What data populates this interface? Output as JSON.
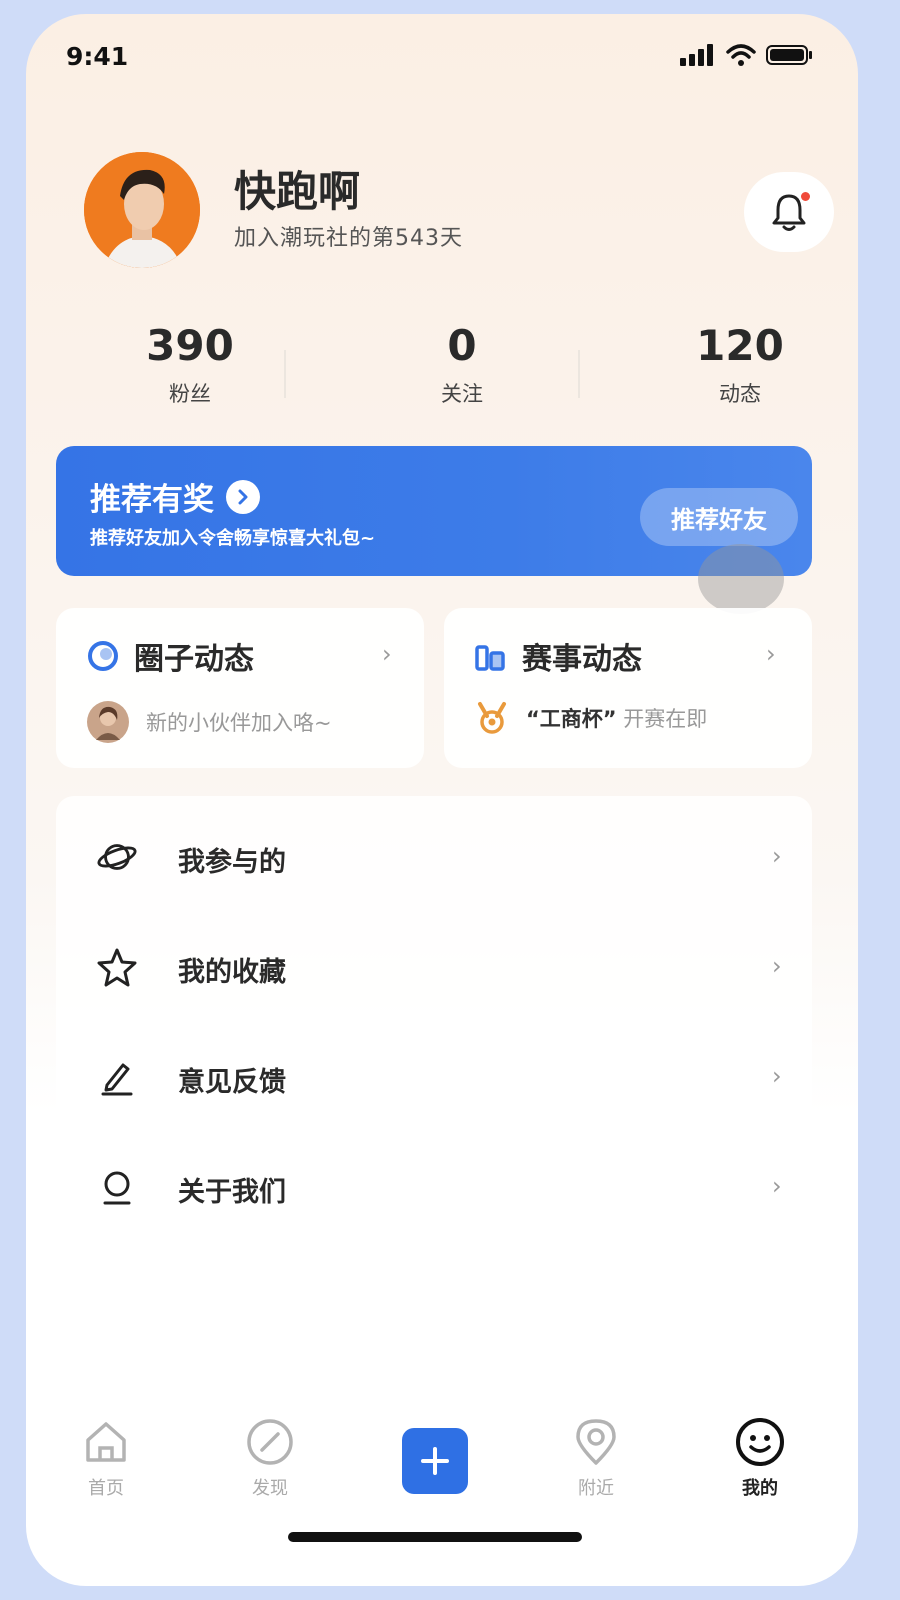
{
  "status_bar": {
    "time": "9:41"
  },
  "profile": {
    "name": "快跑啊",
    "joined_text": "加入潮玩社的第543天"
  },
  "stats": [
    {
      "value": "390",
      "label": "粉丝"
    },
    {
      "value": "0",
      "label": "关注"
    },
    {
      "value": "120",
      "label": "动态"
    }
  ],
  "banner": {
    "title": "推荐有奖",
    "subtitle": "推荐好友加入令舍畅享惊喜大礼包~",
    "button_label": "推荐好友"
  },
  "cards": [
    {
      "title": "圈子动态",
      "icon": "circle-icon",
      "text": "新的小伙伴加入咯~",
      "row_icon": "user-avatar"
    },
    {
      "title": "赛事动态",
      "icon": "chart-icon",
      "text_quote": "“工商杯”",
      "text_rest": "开赛在即",
      "row_icon": "medal-icon"
    }
  ],
  "menu": [
    {
      "label": "我参与的",
      "icon": "planet-icon"
    },
    {
      "label": "我的收藏",
      "icon": "star-icon"
    },
    {
      "label": "意见反馈",
      "icon": "pencil-icon"
    },
    {
      "label": "关于我们",
      "icon": "user-icon"
    }
  ],
  "tabbar": [
    {
      "label": "首页",
      "icon": "home-icon"
    },
    {
      "label": "发现",
      "icon": "compass-icon"
    },
    {
      "label": "",
      "icon": "plus-icon"
    },
    {
      "label": "附近",
      "icon": "location-icon"
    },
    {
      "label": "我的",
      "icon": "smile-icon",
      "active": true
    }
  ],
  "colors": {
    "accent": "#2f70e4",
    "banner": "#3574e6",
    "avatar_bg": "#ef7b1f",
    "notify_dot": "#f04a3a"
  }
}
